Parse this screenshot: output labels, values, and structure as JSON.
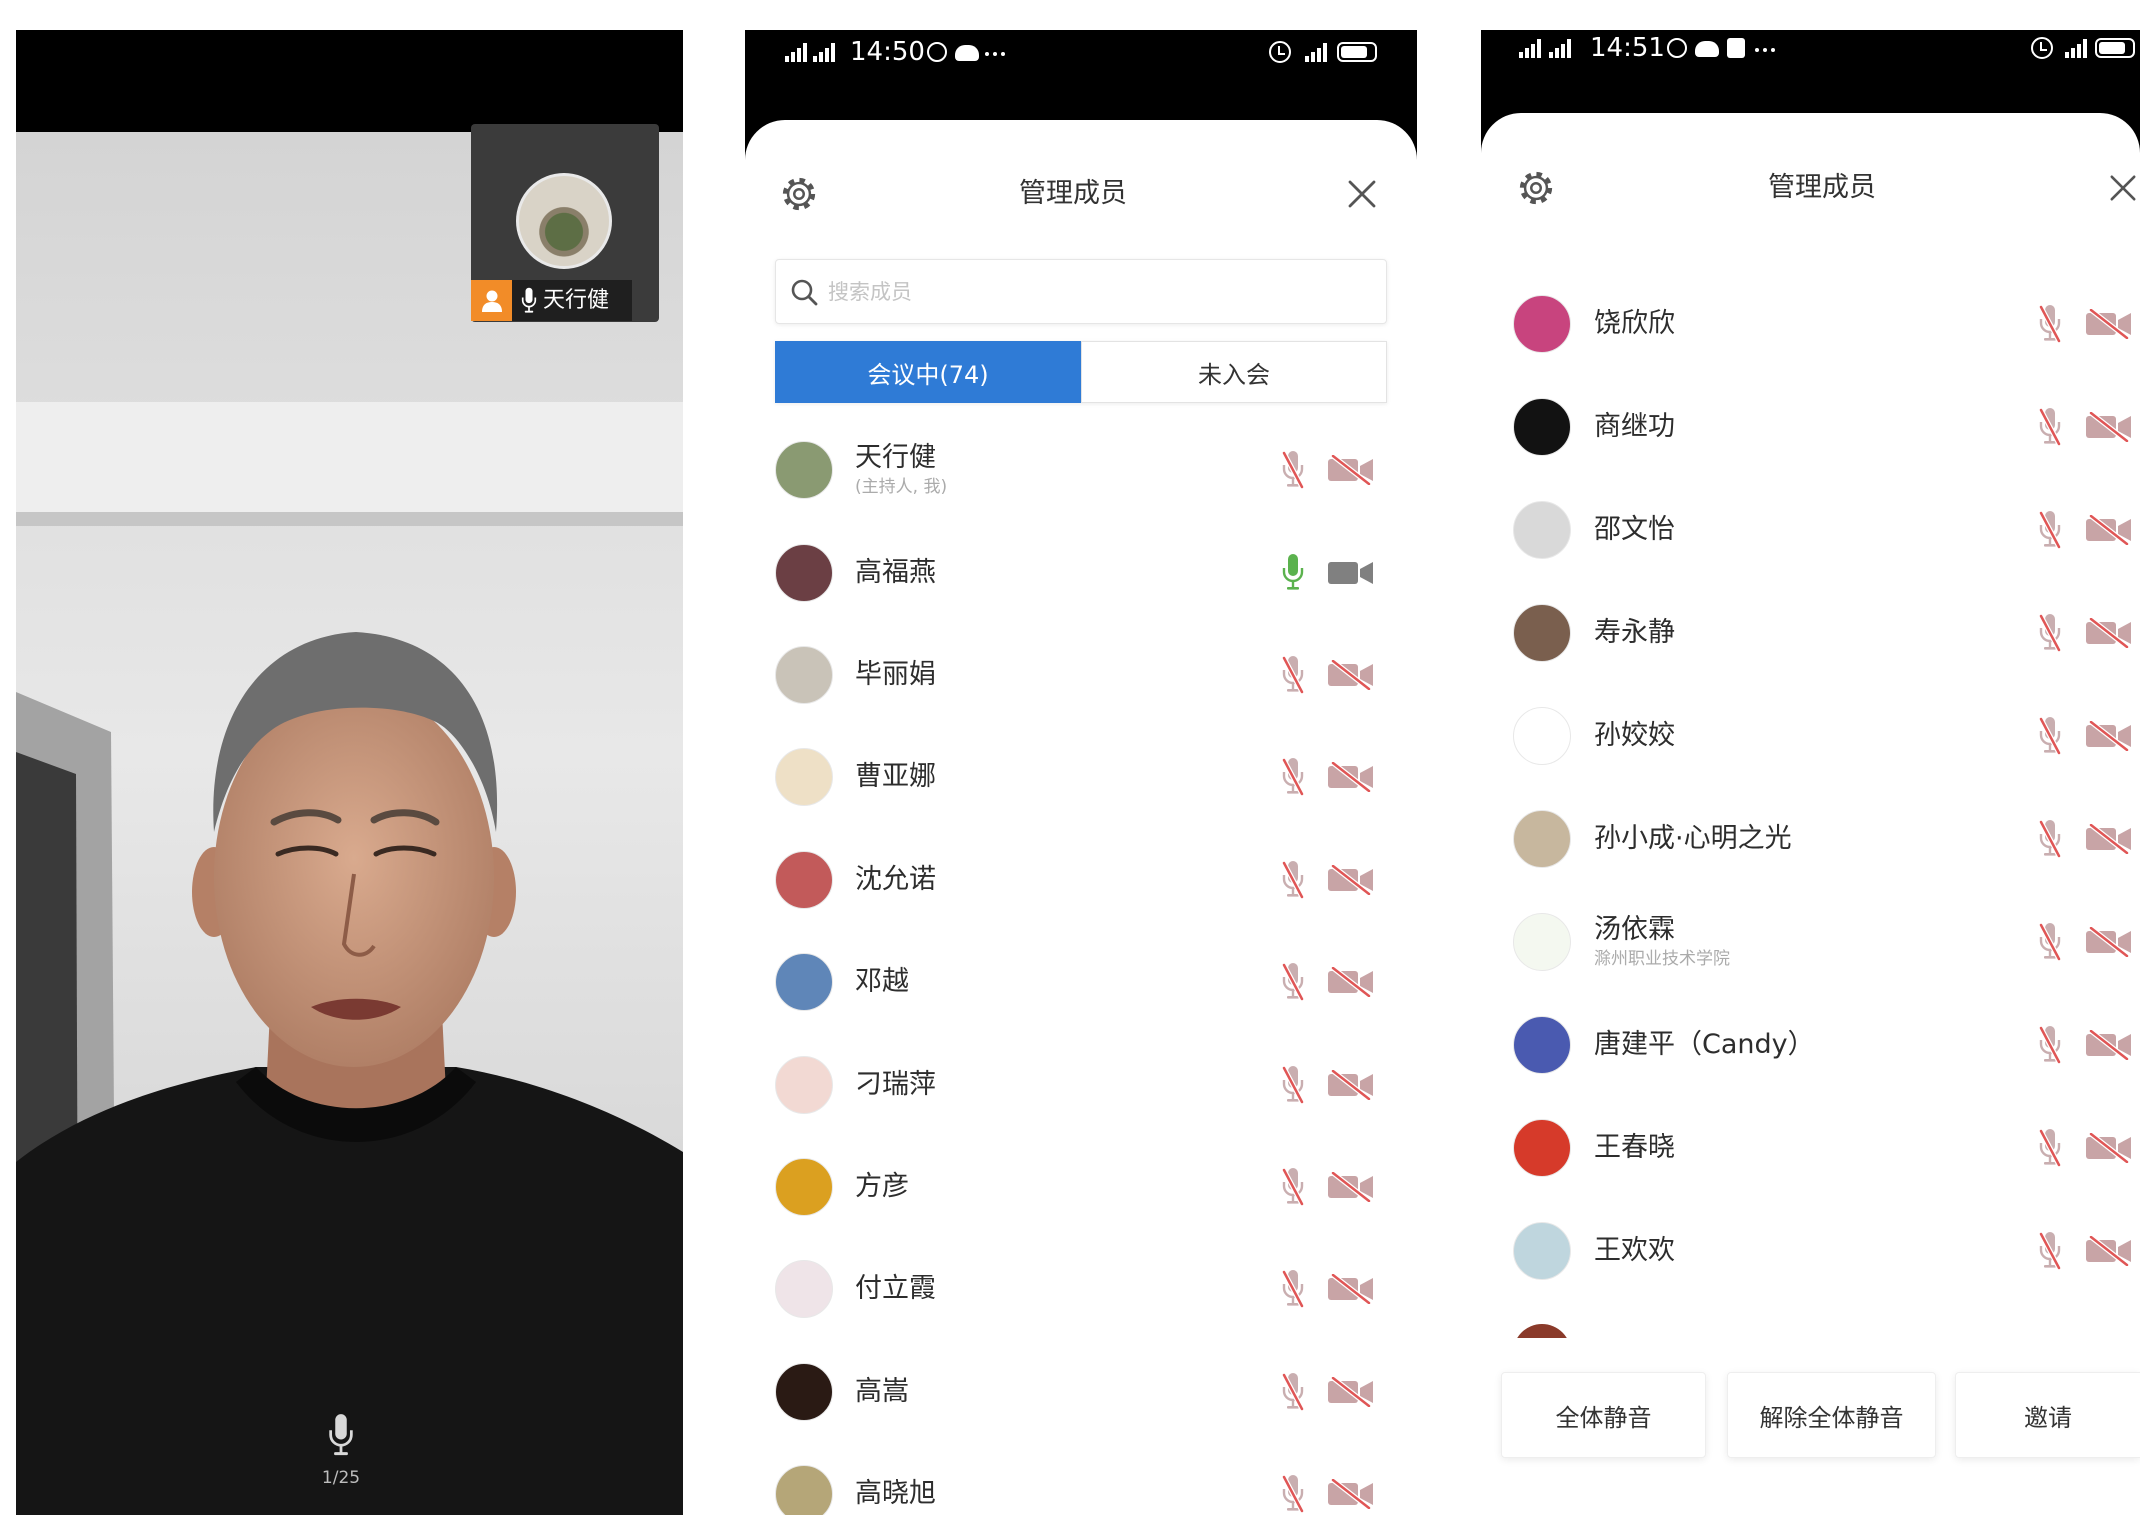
{
  "left_panel": {
    "pip_video": {
      "name": "天行健",
      "badge_icon": "person-icon",
      "mic_icon": "mic-icon"
    },
    "bottom_bar": {
      "mic_icon": "mic-icon",
      "page_indicator": "1/25"
    }
  },
  "middle_panel": {
    "status_bar": {
      "time": "14:50"
    },
    "header": {
      "settings_icon": "gear-icon",
      "title": "管理成员",
      "close_icon": "close-icon"
    },
    "search": {
      "placeholder": "搜索成员",
      "value": "",
      "icon": "search-icon"
    },
    "tabs": [
      {
        "label": "会议中(74)",
        "selected": true
      },
      {
        "label": "未入会",
        "selected": false
      }
    ],
    "members": [
      {
        "name": "天行健",
        "subtitle": "(主持人, 我)",
        "mic": "muted",
        "video": "muted",
        "avatar_color": "#8a9a72"
      },
      {
        "name": "高福燕",
        "mic": "on",
        "video": "on",
        "avatar_color": "#6b3f44"
      },
      {
        "name": "毕丽娟",
        "mic": "muted",
        "video": "muted",
        "avatar_color": "#c9c3b8"
      },
      {
        "name": "曹亚娜",
        "mic": "muted",
        "video": "muted",
        "avatar_color": "#eee0c6"
      },
      {
        "name": "沈允诺",
        "mic": "muted",
        "video": "muted",
        "avatar_color": "#c25a5a"
      },
      {
        "name": "邓越",
        "mic": "muted",
        "video": "muted",
        "avatar_color": "#5f86b8"
      },
      {
        "name": "刁瑞萍",
        "mic": "muted",
        "video": "muted",
        "avatar_color": "#f2d9d3"
      },
      {
        "name": "方彦",
        "mic": "muted",
        "video": "muted",
        "avatar_color": "#dba020"
      },
      {
        "name": "付立霞",
        "mic": "muted",
        "video": "muted",
        "avatar_color": "#efe4e8"
      },
      {
        "name": "高嵩",
        "mic": "muted",
        "video": "muted",
        "avatar_color": "#2a1a14"
      },
      {
        "name": "高晓旭",
        "mic": "muted",
        "video": "muted",
        "avatar_color": "#b5a678"
      }
    ]
  },
  "right_panel": {
    "status_bar": {
      "time": "14:51"
    },
    "header": {
      "settings_icon": "gear-icon",
      "title": "管理成员",
      "close_icon": "close-icon"
    },
    "members": [
      {
        "name": "饶欣欣",
        "mic": "muted",
        "video": "muted",
        "avatar_color": "#c8447e"
      },
      {
        "name": "商继功",
        "mic": "muted",
        "video": "muted",
        "avatar_color": "#121212"
      },
      {
        "name": "邵文怡",
        "mic": "muted",
        "video": "muted",
        "avatar_color": "#d9d9d9"
      },
      {
        "name": "寿永静",
        "mic": "muted",
        "video": "muted",
        "avatar_color": "#7a5f4e"
      },
      {
        "name": "孙姣姣",
        "mic": "muted",
        "video": "muted",
        "avatar_color": "#ffffff"
      },
      {
        "name": "孙小成·心明之光",
        "mic": "muted",
        "video": "muted",
        "avatar_color": "#c7b79e"
      },
      {
        "name": "汤依霖",
        "subtitle": "滁州职业技术学院",
        "mic": "muted",
        "video": "muted",
        "avatar_color": "#f4f8f0"
      },
      {
        "name": "唐建平（Candy）",
        "mic": "muted",
        "video": "muted",
        "avatar_color": "#4a5ab0"
      },
      {
        "name": "王春晓",
        "mic": "muted",
        "video": "muted",
        "avatar_color": "#d63a2a"
      },
      {
        "name": "王欢欢",
        "mic": "muted",
        "video": "muted",
        "avatar_color": "#bfd6de"
      }
    ],
    "actions": [
      {
        "label": "全体静音"
      },
      {
        "label": "解除全体静音"
      },
      {
        "label": "邀请"
      }
    ]
  },
  "colors": {
    "accent_blue": "#2f7bd6",
    "mic_active": "#5bb24e",
    "muted_slash": "#e05656",
    "host_badge": "#f28c28"
  }
}
